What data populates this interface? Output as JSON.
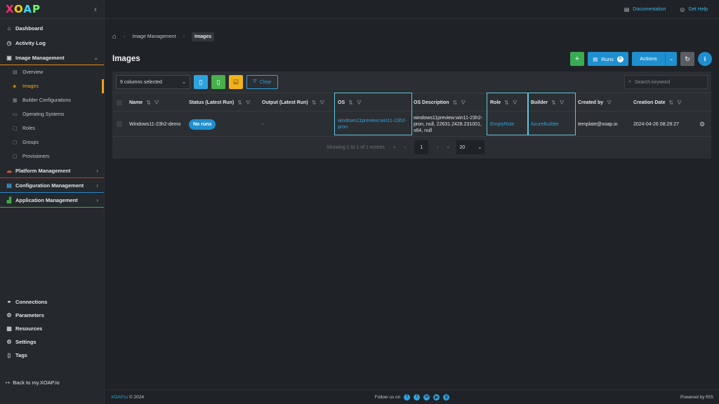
{
  "logo": {
    "text": "XOAP"
  },
  "sidebar": {
    "dashboard": "Dashboard",
    "activity_log": "Activity Log",
    "image_management": "Image Management",
    "sub": [
      "Overview",
      "Images",
      "Builder Configurations",
      "Operating Systems",
      "Roles",
      "Groups",
      "Provisioners"
    ],
    "platform_management": "Platform Management",
    "configuration_management": "Configuration Management",
    "application_management": "Application Management",
    "bottom": [
      "Connections",
      "Parameters",
      "Resources",
      "Settings",
      "Tags"
    ],
    "back": "Back to my.XOAP.io"
  },
  "topbar": {
    "documentation": "Documentation",
    "get_help": "Get Help"
  },
  "breadcrumb": {
    "level1": "Image Management",
    "current": "Images"
  },
  "page": {
    "title": "Images",
    "runs_label": "Runs",
    "runs_count": "0",
    "actions_label": "Actions"
  },
  "table": {
    "columns_selected": "9 columns selected",
    "clear_label": "Clear",
    "search_placeholder": "Search keyword",
    "headers": [
      "Name",
      "Status (Latest Run)",
      "Output (Latest Run)",
      "OS",
      "OS Description",
      "Role",
      "Builder",
      "Created by",
      "Creation Date"
    ],
    "rows": [
      {
        "name": "Windows11-23h2-demo",
        "status": "No runs",
        "output": "-",
        "os": "windows11preview:win11-23h2-pron",
        "os_description": "windows11preview:win11-23h2-pron, null, 22631.2428.231001, x64, null",
        "role": "EmptyRole",
        "builder": "AzureBuilder",
        "created_by": "template@xoap.io",
        "creation_date": "2024-04-26 08:29:27"
      }
    ],
    "pagination_text": "Showing 1 to 1 of 1 entries",
    "current_page": "1",
    "page_size": "20"
  },
  "footer": {
    "copyright_brand": "XOAP.io",
    "copyright_rest": " © 2024",
    "follow": "Follow us on",
    "powered": "Powered by RIS"
  },
  "colors": {
    "accent": "#1f8fcf",
    "active": "#f0a020",
    "add": "#3aab54"
  }
}
